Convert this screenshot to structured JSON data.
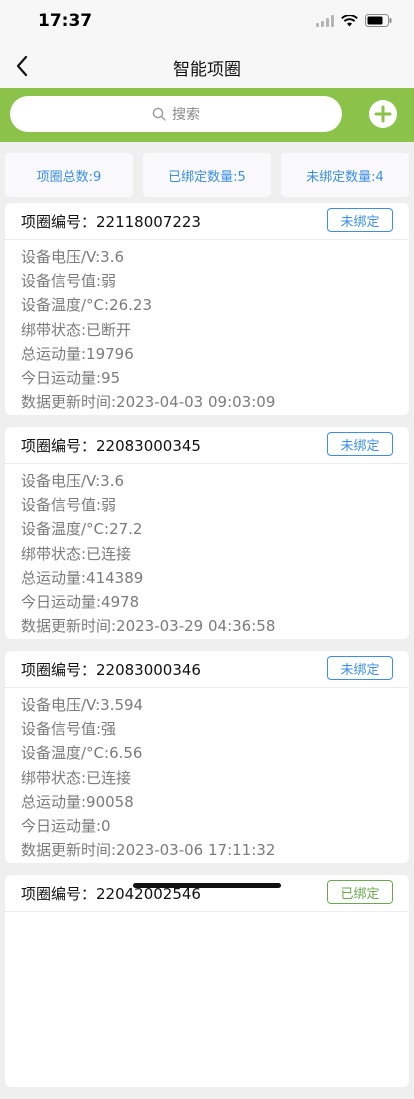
{
  "status_bar": {
    "time": "17:37"
  },
  "nav": {
    "title": "智能项圈",
    "back_icon": "chevron-left-icon"
  },
  "search": {
    "placeholder": "搜索",
    "icon": "search-icon",
    "add_icon": "plus-circle-icon"
  },
  "colors": {
    "accent_green": "#8bc34a",
    "link_blue": "#3a8ee6",
    "bound_green": "#6aa84f"
  },
  "stats": [
    {
      "label": "项圈总数:9"
    },
    {
      "label": "已绑定数量:5"
    },
    {
      "label": "未绑定数量:4"
    }
  ],
  "collars": [
    {
      "code": "项圈编号：22118007223",
      "status": "未绑定",
      "lines": [
        "设备电压/V:3.6",
        "设备信号值:弱",
        "设备温度/°C:26.23",
        "绑带状态:已断开",
        "总运动量:19796",
        "今日运动量:95",
        "数据更新时间:2023-04-03 09:03:09"
      ]
    },
    {
      "code": "项圈编号：22083000345",
      "status": "未绑定",
      "lines": [
        "设备电压/V:3.6",
        "设备信号值:弱",
        "设备温度/°C:27.2",
        "绑带状态:已连接",
        "总运动量:414389",
        "今日运动量:4978",
        "数据更新时间:2023-03-29 04:36:58"
      ]
    },
    {
      "code": "项圈编号：22083000346",
      "status": "未绑定",
      "lines": [
        "设备电压/V:3.594",
        "设备信号值:强",
        "设备温度/°C:6.56",
        "绑带状态:已连接",
        "总运动量:90058",
        "今日运动量:0",
        "数据更新时间:2023-03-06 17:11:32"
      ]
    },
    {
      "code": "项圈编号：22042002546",
      "status": "已绑定",
      "lines": []
    }
  ]
}
